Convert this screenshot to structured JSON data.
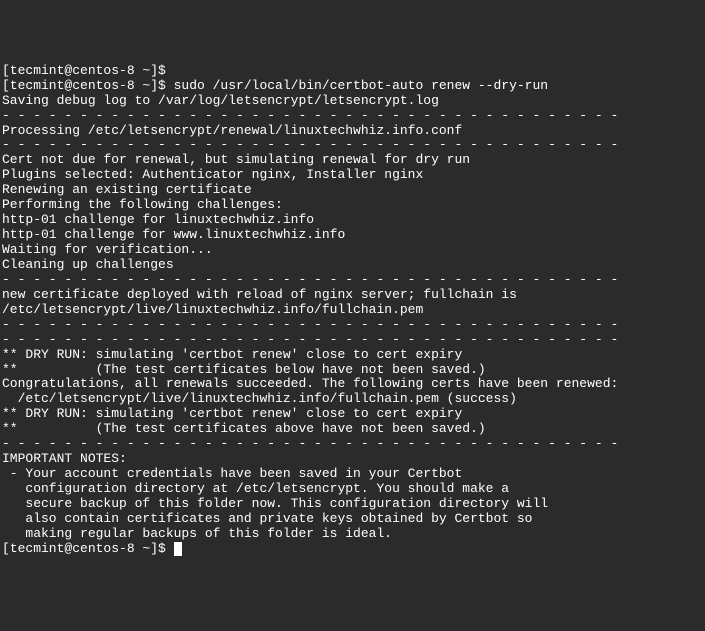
{
  "terminal": {
    "lines": [
      "[tecmint@centos-8 ~]$",
      "[tecmint@centos-8 ~]$ sudo /usr/local/bin/certbot-auto renew --dry-run",
      "Saving debug log to /var/log/letsencrypt/letsencrypt.log",
      "",
      "- - - - - - - - - - - - - - - - - - - - - - - - - - - - - - - - - - - - - - - -",
      "Processing /etc/letsencrypt/renewal/linuxtechwhiz.info.conf",
      "- - - - - - - - - - - - - - - - - - - - - - - - - - - - - - - - - - - - - - - -",
      "Cert not due for renewal, but simulating renewal for dry run",
      "Plugins selected: Authenticator nginx, Installer nginx",
      "Renewing an existing certificate",
      "Performing the following challenges:",
      "http-01 challenge for linuxtechwhiz.info",
      "http-01 challenge for www.linuxtechwhiz.info",
      "Waiting for verification...",
      "Cleaning up challenges",
      "",
      "- - - - - - - - - - - - - - - - - - - - - - - - - - - - - - - - - - - - - - - -",
      "new certificate deployed with reload of nginx server; fullchain is",
      "/etc/letsencrypt/live/linuxtechwhiz.info/fullchain.pem",
      "- - - - - - - - - - - - - - - - - - - - - - - - - - - - - - - - - - - - - - - -",
      "",
      "- - - - - - - - - - - - - - - - - - - - - - - - - - - - - - - - - - - - - - - -",
      "** DRY RUN: simulating 'certbot renew' close to cert expiry",
      "**          (The test certificates below have not been saved.)",
      "",
      "Congratulations, all renewals succeeded. The following certs have been renewed:",
      "  /etc/letsencrypt/live/linuxtechwhiz.info/fullchain.pem (success)",
      "** DRY RUN: simulating 'certbot renew' close to cert expiry",
      "**          (The test certificates above have not been saved.)",
      "- - - - - - - - - - - - - - - - - - - - - - - - - - - - - - - - - - - - - - - -",
      "",
      "IMPORTANT NOTES:",
      " - Your account credentials have been saved in your Certbot",
      "   configuration directory at /etc/letsencrypt. You should make a",
      "   secure backup of this folder now. This configuration directory will",
      "   also contain certificates and private keys obtained by Certbot so",
      "   making regular backups of this folder is ideal."
    ],
    "prompt_final": "[tecmint@centos-8 ~]$ "
  }
}
